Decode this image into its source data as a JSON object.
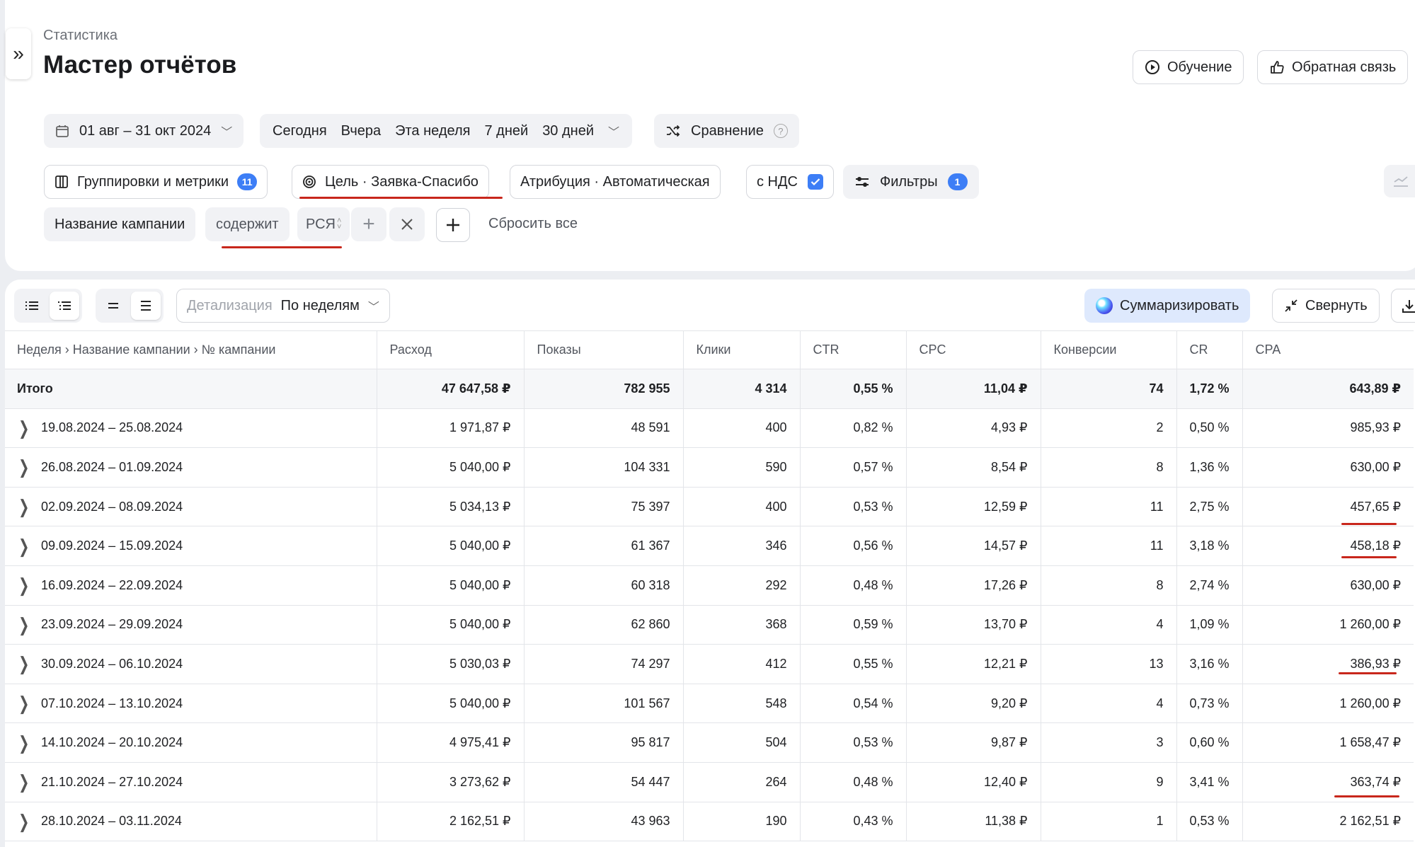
{
  "breadcrumb": "Статистика",
  "title": "Мастер отчётов",
  "header_buttons": {
    "learning": "Обучение",
    "feedback": "Обратная связь"
  },
  "date_range": "01 авг – 31 окт 2024",
  "quick_periods": [
    "Сегодня",
    "Вчера",
    "Эта неделя",
    "7 дней",
    "30 дней"
  ],
  "comparison": "Сравнение",
  "settings": {
    "groupings_label": "Группировки и метрики",
    "groupings_count": "11",
    "goal_label": "Цель · Заявка-Спасибо",
    "attribution_label": "Атрибуция · Автоматическая",
    "vat_label": "с НДС",
    "filters_label": "Фильтры",
    "filters_count": "1"
  },
  "filter": {
    "field": "Название кампании",
    "operator": "содержит",
    "value": "РСЯ",
    "reset_label": "Сбросить все"
  },
  "toolbar": {
    "detail_label": "Детализация",
    "detail_value": "По неделям",
    "summarize_label": "Суммаризировать",
    "collapse_label": "Свернуть"
  },
  "colors": {
    "accent": "#3d7ef6",
    "annotation": "#c8271c"
  },
  "table": {
    "columns": [
      "Неделя › Название кампании › № кампании",
      "Расход",
      "Показы",
      "Клики",
      "CTR",
      "CPC",
      "Конверсии",
      "CR",
      "CPA"
    ],
    "total": [
      "Итого",
      "47 647,58 ₽",
      "782 955",
      "4 314",
      "0,55 %",
      "11,04 ₽",
      "74",
      "1,72 %",
      "643,89 ₽"
    ],
    "rows": [
      [
        "19.08.2024 – 25.08.2024",
        "1 971,87 ₽",
        "48 591",
        "400",
        "0,82 %",
        "4,93 ₽",
        "2",
        "0,50 %",
        "985,93 ₽"
      ],
      [
        "26.08.2024 – 01.09.2024",
        "5 040,00 ₽",
        "104 331",
        "590",
        "0,57 %",
        "8,54 ₽",
        "8",
        "1,36 %",
        "630,00 ₽"
      ],
      [
        "02.09.2024 – 08.09.2024",
        "5 034,13 ₽",
        "75 397",
        "400",
        "0,53 %",
        "12,59 ₽",
        "11",
        "2,75 %",
        "457,65 ₽"
      ],
      [
        "09.09.2024 – 15.09.2024",
        "5 040,00 ₽",
        "61 367",
        "346",
        "0,56 %",
        "14,57 ₽",
        "11",
        "3,18 %",
        "458,18 ₽"
      ],
      [
        "16.09.2024 – 22.09.2024",
        "5 040,00 ₽",
        "60 318",
        "292",
        "0,48 %",
        "17,26 ₽",
        "8",
        "2,74 %",
        "630,00 ₽"
      ],
      [
        "23.09.2024 – 29.09.2024",
        "5 040,00 ₽",
        "62 860",
        "368",
        "0,59 %",
        "13,70 ₽",
        "4",
        "1,09 %",
        "1 260,00 ₽"
      ],
      [
        "30.09.2024 – 06.10.2024",
        "5 030,03 ₽",
        "74 297",
        "412",
        "0,55 %",
        "12,21 ₽",
        "13",
        "3,16 %",
        "386,93 ₽"
      ],
      [
        "07.10.2024 – 13.10.2024",
        "5 040,00 ₽",
        "101 567",
        "548",
        "0,54 %",
        "9,20 ₽",
        "4",
        "0,73 %",
        "1 260,00 ₽"
      ],
      [
        "14.10.2024 – 20.10.2024",
        "4 975,41 ₽",
        "95 817",
        "504",
        "0,53 %",
        "9,87 ₽",
        "3",
        "0,60 %",
        "1 658,47 ₽"
      ],
      [
        "21.10.2024 – 27.10.2024",
        "3 273,62 ₽",
        "54 447",
        "264",
        "0,48 %",
        "12,40 ₽",
        "9",
        "3,41 %",
        "363,74 ₽"
      ],
      [
        "28.10.2024 – 03.11.2024",
        "2 162,51 ₽",
        "43 963",
        "190",
        "0,43 %",
        "11,38 ₽",
        "1",
        "0,53 %",
        "2 162,51 ₽"
      ]
    ]
  }
}
